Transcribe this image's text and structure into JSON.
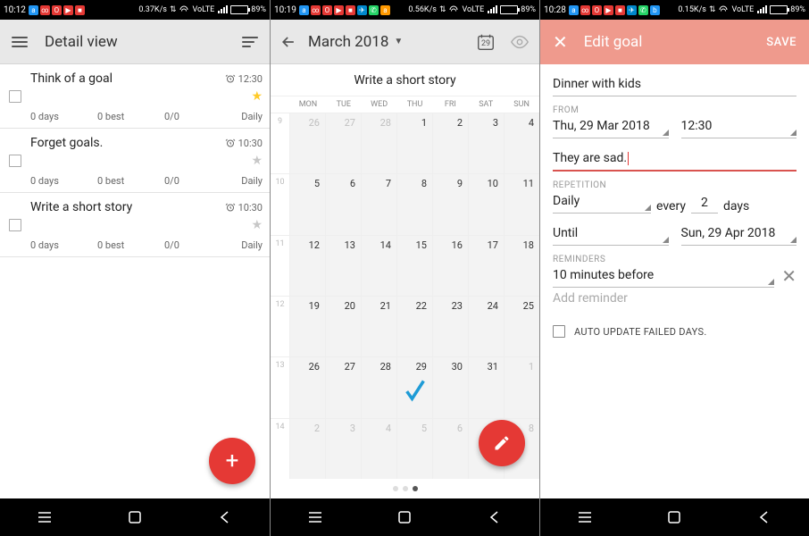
{
  "screen1": {
    "statusbar": {
      "time": "10:12",
      "net": "0.37K/s",
      "volte": "VoLTE",
      "batt": "89%"
    },
    "toolbar": {
      "title": "Detail view"
    },
    "goals": [
      {
        "title": "Think of a goal",
        "time": "12:30",
        "starred": true,
        "days": "0 days",
        "best": "0 best",
        "ratio": "0/0",
        "freq": "Daily"
      },
      {
        "title": "Forget goals.",
        "time": "10:30",
        "starred": false,
        "days": "0 days",
        "best": "0 best",
        "ratio": "0/0",
        "freq": "Daily"
      },
      {
        "title": "Write a short story",
        "time": "10:30",
        "starred": false,
        "days": "0 days",
        "best": "0 best",
        "ratio": "0/0",
        "freq": "Daily"
      }
    ]
  },
  "screen2": {
    "statusbar": {
      "time": "10:19",
      "net": "0.56K/s",
      "volte": "VoLTE",
      "batt": "89%"
    },
    "toolbar": {
      "month": "March 2018",
      "today_num": "29"
    },
    "subtitle": "Write a short story",
    "dow": [
      "MON",
      "TUE",
      "WED",
      "THU",
      "FRI",
      "SAT",
      "SUN"
    ],
    "weeks": [
      {
        "wn": "9",
        "cells": [
          {
            "n": "26",
            "o": true
          },
          {
            "n": "27",
            "o": true
          },
          {
            "n": "28",
            "o": true
          },
          {
            "n": "1"
          },
          {
            "n": "2"
          },
          {
            "n": "3"
          },
          {
            "n": "4"
          }
        ]
      },
      {
        "wn": "10",
        "cells": [
          {
            "n": "5"
          },
          {
            "n": "6"
          },
          {
            "n": "7"
          },
          {
            "n": "8"
          },
          {
            "n": "9"
          },
          {
            "n": "10"
          },
          {
            "n": "11"
          }
        ]
      },
      {
        "wn": "11",
        "cells": [
          {
            "n": "12"
          },
          {
            "n": "13"
          },
          {
            "n": "14"
          },
          {
            "n": "15"
          },
          {
            "n": "16"
          },
          {
            "n": "17"
          },
          {
            "n": "18"
          }
        ]
      },
      {
        "wn": "12",
        "cells": [
          {
            "n": "19"
          },
          {
            "n": "20"
          },
          {
            "n": "21"
          },
          {
            "n": "22"
          },
          {
            "n": "23"
          },
          {
            "n": "24"
          },
          {
            "n": "25"
          }
        ]
      },
      {
        "wn": "13",
        "cells": [
          {
            "n": "26"
          },
          {
            "n": "27"
          },
          {
            "n": "28"
          },
          {
            "n": "29",
            "today": true,
            "check": true
          },
          {
            "n": "30"
          },
          {
            "n": "31"
          },
          {
            "n": "1",
            "o": true
          }
        ]
      },
      {
        "wn": "14",
        "cells": [
          {
            "n": "2",
            "o": true
          },
          {
            "n": "3",
            "o": true
          },
          {
            "n": "4",
            "o": true
          },
          {
            "n": "5",
            "o": true
          },
          {
            "n": "6",
            "o": true
          },
          {
            "n": "7",
            "o": true
          },
          {
            "n": "8",
            "o": true
          }
        ]
      }
    ]
  },
  "screen3": {
    "statusbar": {
      "time": "10:28",
      "net": "0.15K/s",
      "volte": "VoLTE",
      "batt": "89%"
    },
    "toolbar": {
      "title": "Edit goal",
      "save": "SAVE"
    },
    "name": "Dinner with kids",
    "from_label": "FROM",
    "from_date": "Thu, 29 Mar 2018",
    "from_time": "12:30",
    "note": "They are sad.",
    "rep_label": "REPETITION",
    "rep_mode": "Daily",
    "rep_every": "every",
    "rep_n": "2",
    "rep_unit": "days",
    "until_label": "Until",
    "until_date": "Sun, 29 Apr 2018",
    "reminders_label": "REMINDERS",
    "reminder1": "10 minutes before",
    "add_reminder": "Add reminder",
    "auto_label": "AUTO UPDATE FAILED DAYS."
  }
}
